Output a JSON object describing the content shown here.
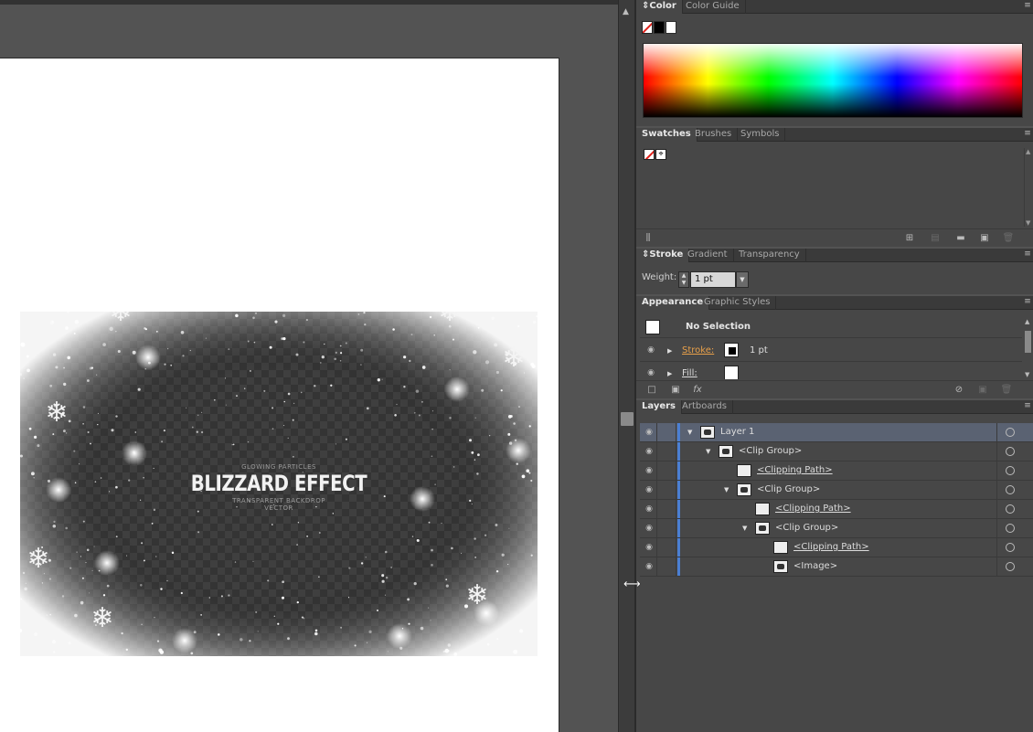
{
  "panels": {
    "color": {
      "tabs": [
        "Color",
        "Color Guide"
      ],
      "active_tab": "Color"
    },
    "swatches": {
      "tabs": [
        "Swatches",
        "Brushes",
        "Symbols"
      ],
      "active_tab": "Swatches",
      "registration_glyph": "⌖"
    },
    "stroke": {
      "tabs": [
        "Stroke",
        "Gradient",
        "Transparency"
      ],
      "active_tab": "Stroke",
      "weight_label": "Weight:",
      "weight_value": "1 pt"
    },
    "appearance": {
      "tabs": [
        "Appearance",
        "Graphic Styles"
      ],
      "active_tab": "Appearance",
      "selection_label": "No Selection",
      "stroke_label": "Stroke:",
      "stroke_value": "1 pt",
      "fill_label": "Fill:",
      "fx_label": "fx"
    },
    "layers": {
      "tabs": [
        "Layers",
        "Artboards"
      ],
      "active_tab": "Layers",
      "rows": [
        {
          "label": "Layer 1",
          "depth": 0,
          "expanded": true,
          "thumb": "img",
          "underline": false
        },
        {
          "label": "<Clip Group>",
          "depth": 1,
          "expanded": true,
          "thumb": "img",
          "underline": false
        },
        {
          "label": "<Clipping Path>",
          "depth": 2,
          "expanded": null,
          "thumb": "blank",
          "underline": true
        },
        {
          "label": "<Clip Group>",
          "depth": 2,
          "expanded": true,
          "thumb": "img",
          "underline": false
        },
        {
          "label": "<Clipping Path>",
          "depth": 3,
          "expanded": null,
          "thumb": "blank",
          "underline": true
        },
        {
          "label": "<Clip Group>",
          "depth": 3,
          "expanded": true,
          "thumb": "img",
          "underline": false
        },
        {
          "label": "<Clipping Path>",
          "depth": 4,
          "expanded": null,
          "thumb": "blank",
          "underline": true
        },
        {
          "label": "<Image>",
          "depth": 4,
          "expanded": null,
          "thumb": "img",
          "underline": false
        }
      ]
    }
  },
  "artwork": {
    "top_line": "GLOWING PARTICLES",
    "title": "BLIZZARD EFFECT",
    "sub_line1": "TRANSPARENT BACKDROP",
    "sub_line2": "VECTOR"
  },
  "colors": {
    "ui_bg": "#535353",
    "panel_bg": "#474747",
    "layer_highlight": "#5a6272",
    "layer_color_bar": "#4b7fd3",
    "stroke_label_accent": "#e8a04a",
    "artboard": "#ffffff"
  }
}
